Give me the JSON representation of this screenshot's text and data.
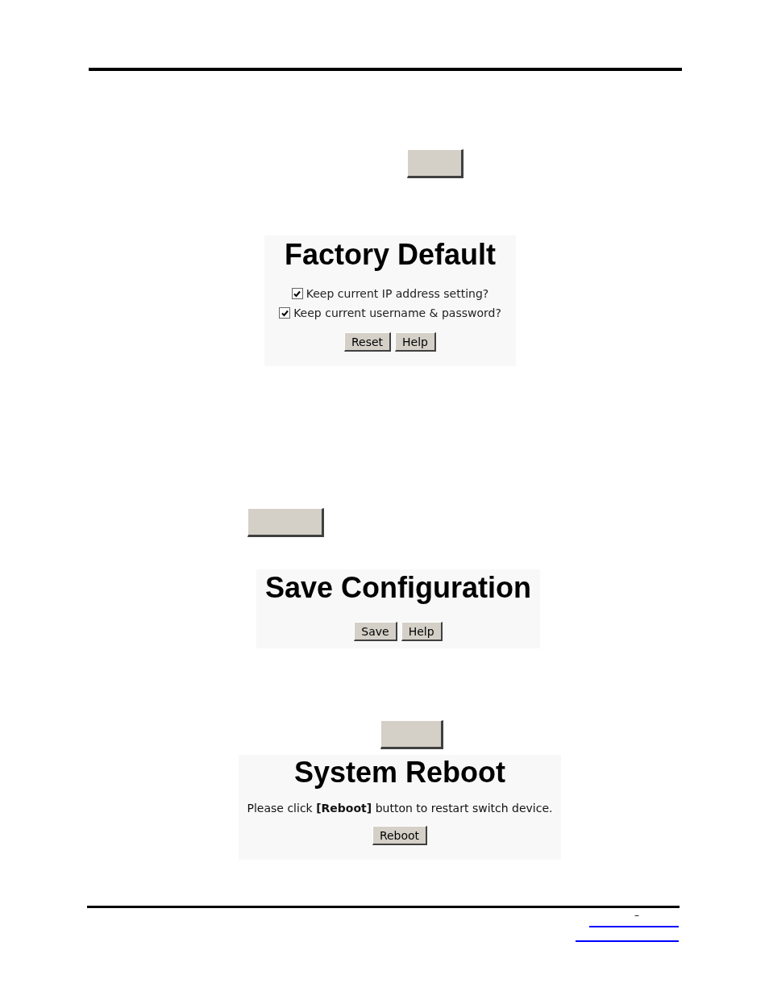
{
  "factory_default": {
    "title": "Factory Default",
    "options": [
      {
        "label": "Keep current IP address setting?",
        "checked": true
      },
      {
        "label": "Keep current username & password?",
        "checked": true
      }
    ],
    "buttons": [
      "Reset",
      "Help"
    ]
  },
  "save_configuration": {
    "title": "Save Configuration",
    "buttons": [
      "Save",
      "Help"
    ]
  },
  "system_reboot": {
    "title": "System Reboot",
    "message": "Please click **[Reboot]** button to restart switch device.",
    "buttons": [
      "Reboot"
    ]
  },
  "footer": {
    "mark": "–"
  }
}
